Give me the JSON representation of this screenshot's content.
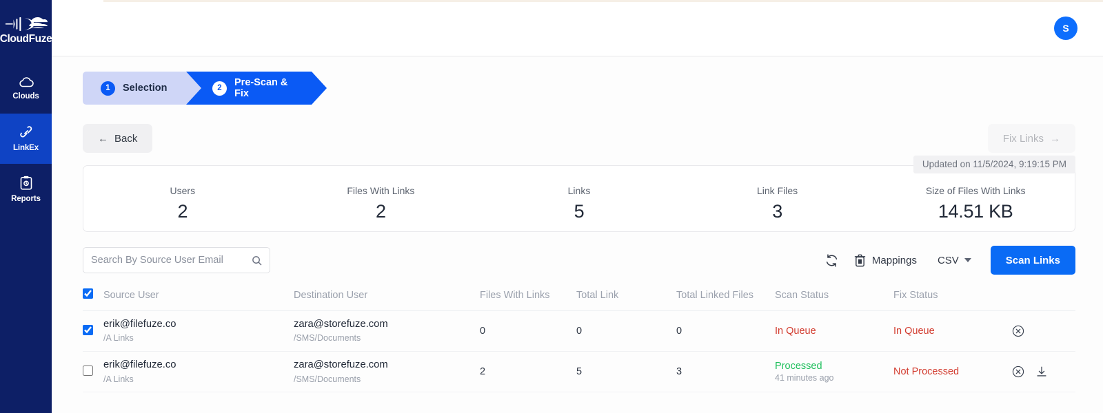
{
  "sidebar": {
    "logo_text": "CloudFuze",
    "items": [
      {
        "label": "Clouds",
        "icon": "cloud-icon",
        "active": false
      },
      {
        "label": "LinkEx",
        "icon": "link-icon",
        "active": true
      },
      {
        "label": "Reports",
        "icon": "clipboard-icon",
        "active": false
      }
    ]
  },
  "topbar": {
    "avatar_initial": "S"
  },
  "steps": [
    {
      "number": "1",
      "label": "Selection"
    },
    {
      "number": "2",
      "label": "Pre-Scan & Fix"
    }
  ],
  "nav": {
    "back_label": "Back",
    "back_arrow": "←",
    "fix_label": "Fix Links",
    "fix_arrow": "→"
  },
  "stats": {
    "updated_text": "Updated on 11/5/2024, 9:19:15 PM",
    "items": [
      {
        "label": "Users",
        "value": "2"
      },
      {
        "label": "Files With Links",
        "value": "2"
      },
      {
        "label": "Links",
        "value": "5"
      },
      {
        "label": "Link Files",
        "value": "3"
      },
      {
        "label": "Size of Files With Links",
        "value": "14.51 KB"
      }
    ]
  },
  "toolbar": {
    "search_placeholder": "Search By Source User Email",
    "search_value": "",
    "refresh_icon": "refresh-icon",
    "mappings_label": "Mappings",
    "mappings_icon": "trash-icon",
    "export_label": "CSV",
    "scan_label": "Scan Links"
  },
  "table": {
    "headers": {
      "source": "Source User",
      "destination": "Destination User",
      "files_with_links": "Files With Links",
      "total_link": "Total Link",
      "total_linked_files": "Total Linked Files",
      "scan_status": "Scan Status",
      "fix_status": "Fix Status"
    },
    "header_checked": true,
    "rows": [
      {
        "checked": true,
        "source_user": "erik@filefuze.co",
        "source_path": "/A Links",
        "destination_user": "zara@storefuze.com",
        "destination_path": "/SMS/Documents",
        "files_with_links": "0",
        "total_link": "0",
        "total_linked_files": "0",
        "scan_status": "In Queue",
        "scan_status_kind": "queue",
        "scan_time": "",
        "fix_status": "In Queue",
        "fix_status_kind": "queue",
        "has_download": false
      },
      {
        "checked": false,
        "source_user": "erik@filefuze.co",
        "source_path": "/A Links",
        "destination_user": "zara@storefuze.com",
        "destination_path": "/SMS/Documents",
        "files_with_links": "2",
        "total_link": "5",
        "total_linked_files": "3",
        "scan_status": "Processed",
        "scan_status_kind": "ok",
        "scan_time": "41 minutes ago",
        "fix_status": "Not Processed",
        "fix_status_kind": "bad",
        "has_download": true
      }
    ]
  },
  "colors": {
    "sidebar_bg": "#0d1f66",
    "sidebar_active": "#0f43c4",
    "accent_blue": "#0a6bf5",
    "step_inactive": "#cfd6f7",
    "status_ok": "#1fbf5c",
    "status_error": "#d23b2e"
  }
}
